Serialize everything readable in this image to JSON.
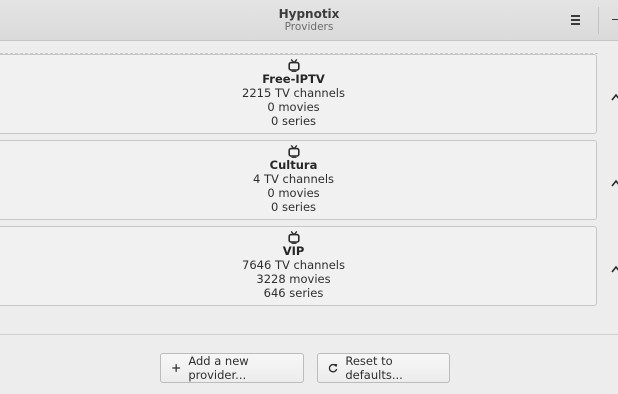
{
  "window": {
    "title": "Hypnotix",
    "subtitle": "Providers"
  },
  "header": {
    "menu_icon": "hamburger-menu-icon",
    "minimize_icon": "minimize-icon"
  },
  "providers": [
    {
      "name": "Free-IPTV",
      "tv_channels": "2215 TV channels",
      "movies": "0 movies",
      "series": "0 series",
      "icon": "tv-icon"
    },
    {
      "name": "Cultura",
      "tv_channels": "4 TV channels",
      "movies": "0 movies",
      "series": "0 series",
      "icon": "tv-icon"
    },
    {
      "name": "VIP",
      "tv_channels": "7646 TV channels",
      "movies": "3228 movies",
      "series": "646 series",
      "icon": "tv-icon"
    }
  ],
  "actions": {
    "add_label": "Add a new provider...",
    "add_icon": "plus-icon",
    "reset_label": "Reset to defaults...",
    "reset_icon": "refresh-icon"
  }
}
